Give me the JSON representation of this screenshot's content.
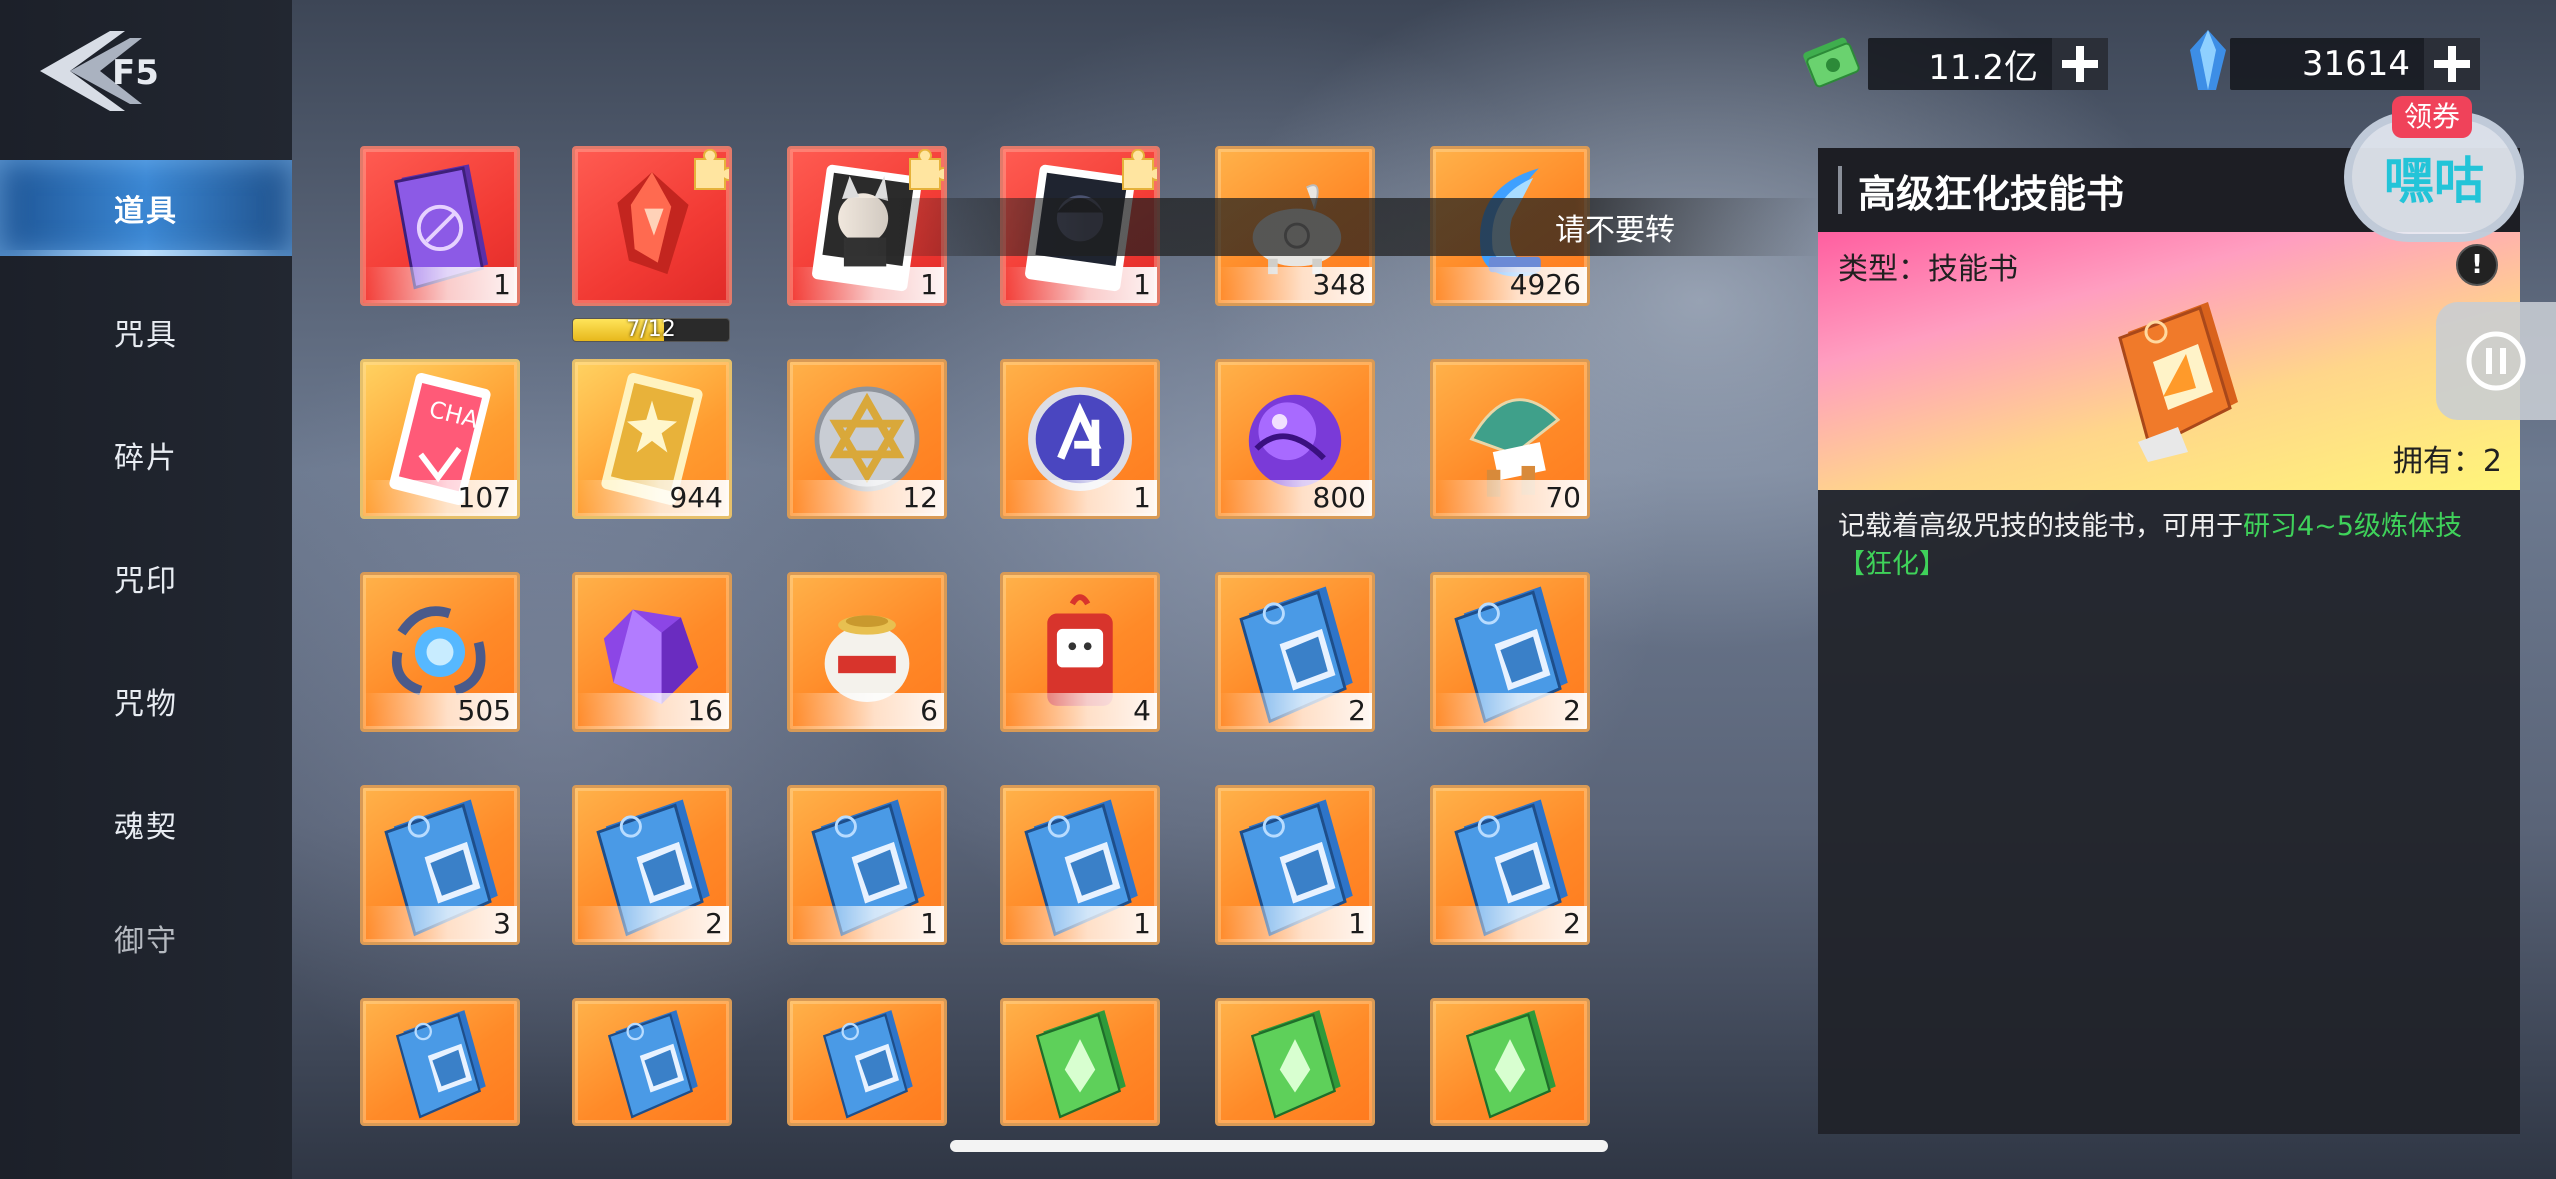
{
  "sidebar": {
    "items": [
      {
        "label": "道具",
        "active": true
      },
      {
        "label": "咒具",
        "active": false
      },
      {
        "label": "碎片",
        "active": false
      },
      {
        "label": "咒印",
        "active": false
      },
      {
        "label": "咒物",
        "active": false
      },
      {
        "label": "魂契",
        "active": false
      },
      {
        "label": "御守",
        "active": false
      }
    ]
  },
  "currency": {
    "gold": {
      "value": "11.2亿",
      "icon": "cash-icon",
      "color": "#5fce6a"
    },
    "gem": {
      "value": "31614",
      "icon": "crystal-icon",
      "color": "#4fa8f0"
    }
  },
  "toast": {
    "text": "请不要转"
  },
  "inventory": {
    "items": [
      {
        "name": "purple-book",
        "count": "1",
        "frame": "red"
      },
      {
        "name": "red-gem-shard",
        "count": "",
        "frame": "red",
        "progress": {
          "text": "7/12",
          "fraction": 0.583
        }
      },
      {
        "name": "character-card-fox",
        "count": "1",
        "frame": "red"
      },
      {
        "name": "character-card-dark",
        "count": "1",
        "frame": "red"
      },
      {
        "name": "ghost-pig",
        "count": "348",
        "frame": "orange"
      },
      {
        "name": "blue-crescent",
        "count": "4926",
        "frame": "orange"
      },
      {
        "name": "red-ticket",
        "count": "107",
        "frame": "gold"
      },
      {
        "name": "gold-ticket",
        "count": "944",
        "frame": "gold"
      },
      {
        "name": "star-coin",
        "count": "12",
        "frame": "orange"
      },
      {
        "name": "blue-coin",
        "count": "1",
        "frame": "orange"
      },
      {
        "name": "purple-orb",
        "count": "800",
        "frame": "orange"
      },
      {
        "name": "fan-charm",
        "count": "70",
        "frame": "orange"
      },
      {
        "name": "blue-orb-claw",
        "count": "505",
        "frame": "orange"
      },
      {
        "name": "purple-crystal",
        "count": "16",
        "frame": "orange"
      },
      {
        "name": "clay-jar",
        "count": "6",
        "frame": "orange"
      },
      {
        "name": "red-omamori",
        "count": "4",
        "frame": "orange"
      },
      {
        "name": "blue-skill-book",
        "count": "2",
        "frame": "orange"
      },
      {
        "name": "blue-skill-book",
        "count": "2",
        "frame": "orange"
      },
      {
        "name": "blue-skill-book",
        "count": "3",
        "frame": "orange"
      },
      {
        "name": "blue-skill-book",
        "count": "2",
        "frame": "orange"
      },
      {
        "name": "blue-skill-book",
        "count": "1",
        "frame": "orange"
      },
      {
        "name": "blue-skill-book",
        "count": "1",
        "frame": "orange"
      },
      {
        "name": "blue-skill-book",
        "count": "1",
        "frame": "orange"
      },
      {
        "name": "blue-skill-book",
        "count": "2",
        "frame": "orange"
      },
      {
        "name": "blue-skill-book",
        "count": "",
        "frame": "orange"
      },
      {
        "name": "blue-skill-book",
        "count": "",
        "frame": "orange"
      },
      {
        "name": "blue-skill-book",
        "count": "",
        "frame": "orange"
      },
      {
        "name": "green-skill-book",
        "count": "",
        "frame": "orange"
      },
      {
        "name": "green-skill-book",
        "count": "",
        "frame": "orange"
      },
      {
        "name": "green-skill-book",
        "count": "",
        "frame": "orange"
      }
    ]
  },
  "detail": {
    "title": "高级狂化技能书",
    "type_label": "类型：技能书",
    "owned_label": "拥有：2",
    "desc_prefix": "记载着高级咒技的技能书，可用于",
    "desc_highlight": "研习4~5级炼体技【狂化】",
    "info_glyph": "!"
  },
  "float_widget": {
    "tag": "领券",
    "label": "嘿咕"
  }
}
